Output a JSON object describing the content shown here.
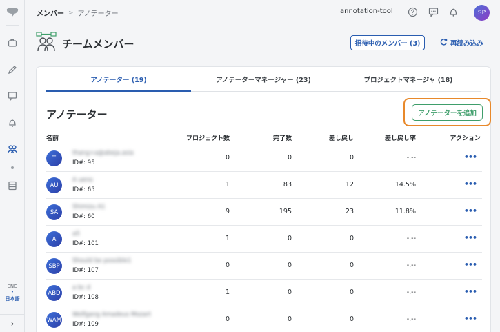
{
  "breadcrumb": {
    "current": "メンバー",
    "next": "アノテーター"
  },
  "project_name": "annotation-tool",
  "user_avatar": "SP",
  "page_title": "チームメンバー",
  "invite_button": "招待中のメンバー (3)",
  "reload_button": "再読み込み",
  "tabs": [
    {
      "label": "アノテーター (19)"
    },
    {
      "label": "アノテーターマネージャー (23)"
    },
    {
      "label": "プロジェクトマネージャ (18)"
    }
  ],
  "section_title": "アノテーター",
  "add_button": "アノテーターを追加",
  "columns": {
    "name": "名前",
    "projects": "プロジェクト数",
    "completed": "完了数",
    "returned": "差し戻し",
    "return_rate": "差し戻し率",
    "action": "アクション"
  },
  "rows": [
    {
      "initials": "T",
      "name": "thang+a@abeja.asia",
      "id": "ID#: 95",
      "projects": "0",
      "completed": "0",
      "returned": "0",
      "rate": "-.--"
    },
    {
      "initials": "AU",
      "name": "A ueno",
      "id": "ID#: 65",
      "projects": "1",
      "completed": "83",
      "returned": "12",
      "rate": "14.5%"
    },
    {
      "initials": "SA",
      "name": "Shimizu A1",
      "id": "ID#: 60",
      "projects": "9",
      "completed": "195",
      "returned": "23",
      "rate": "11.8%"
    },
    {
      "initials": "A",
      "name": "a5",
      "id": "ID#: 101",
      "projects": "1",
      "completed": "0",
      "returned": "0",
      "rate": "-.--"
    },
    {
      "initials": "SBP",
      "name": "Should be possible1",
      "id": "ID#: 107",
      "projects": "0",
      "completed": "0",
      "returned": "0",
      "rate": "-.--"
    },
    {
      "initials": "ABD",
      "name": "a bc d",
      "id": "ID#: 108",
      "projects": "1",
      "completed": "0",
      "returned": "0",
      "rate": "-.--"
    },
    {
      "initials": "WAM",
      "name": "Wolfgang Amadeus Mozart",
      "id": "ID#: 109",
      "projects": "0",
      "completed": "0",
      "returned": "0",
      "rate": "-.--"
    }
  ],
  "action_glyph": "•••",
  "language": {
    "eng": "ENG",
    "dot": "•",
    "ja": "日本語"
  },
  "colors": {
    "accent": "#2a5db0",
    "add_button": "#3f9e6b",
    "highlight": "#e8892b"
  }
}
